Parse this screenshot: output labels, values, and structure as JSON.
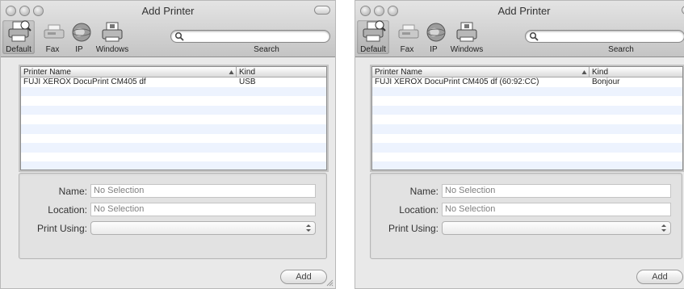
{
  "windows": [
    {
      "title": "Add Printer",
      "toolbar": {
        "default_label": "Default",
        "fax_label": "Fax",
        "ip_label": "IP",
        "windows_label": "Windows",
        "search_label": "Search",
        "search_value": ""
      },
      "list": {
        "col_name": "Printer Name",
        "col_kind": "Kind",
        "rows": [
          {
            "name": "FUJI XEROX DocuPrint CM405 df",
            "kind": "USB"
          }
        ]
      },
      "form": {
        "name_label": "Name:",
        "name_value": "No Selection",
        "location_label": "Location:",
        "location_value": "No Selection",
        "print_using_label": "Print Using:",
        "print_using_value": ""
      },
      "add_label": "Add"
    },
    {
      "title": "Add Printer",
      "toolbar": {
        "default_label": "Default",
        "fax_label": "Fax",
        "ip_label": "IP",
        "windows_label": "Windows",
        "search_label": "Search",
        "search_value": ""
      },
      "list": {
        "col_name": "Printer Name",
        "col_kind": "Kind",
        "rows": [
          {
            "name": "FUJI XEROX DocuPrint CM405 df (60:92:CC)",
            "kind": "Bonjour"
          }
        ]
      },
      "form": {
        "name_label": "Name:",
        "name_value": "No Selection",
        "location_label": "Location:",
        "location_value": "No Selection",
        "print_using_label": "Print Using:",
        "print_using_value": ""
      },
      "add_label": "Add"
    }
  ],
  "icons": {
    "default": "default-printer-icon",
    "fax": "fax-icon",
    "ip": "ip-globe-icon",
    "windows": "windows-printer-icon",
    "search": "search-icon",
    "sort": "sort-ascending-icon",
    "stepper": "popup-arrows-icon",
    "resize": "resize-grip-icon"
  },
  "colors": {
    "alt_row": "#edf3fe",
    "titlebar_top": "#e4e4e4",
    "titlebar_bottom": "#c4c4c4",
    "window_bg": "#e9e9e9"
  }
}
